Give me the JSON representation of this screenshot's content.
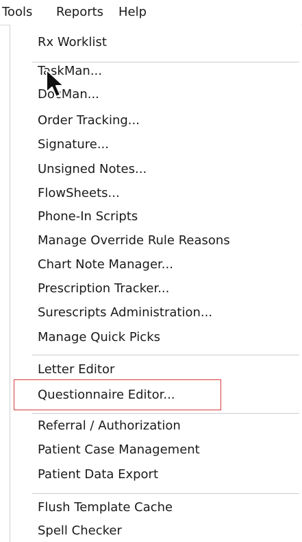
{
  "menubar": {
    "tools": "Tools",
    "reports": "Reports",
    "help": "Help"
  },
  "tools_menu": {
    "items": [
      "Rx Worklist",
      "TaskMan...",
      "DocMan...",
      "Order Tracking...",
      "Signature...",
      "Unsigned Notes...",
      "FlowSheets...",
      "Phone-In Scripts",
      "Manage Override Rule Reasons",
      "Chart Note Manager...",
      "Prescription Tracker...",
      "Surescripts Administration...",
      "Manage Quick Picks",
      "Letter Editor",
      "Questionnaire Editor...",
      "Referral / Authorization",
      "Patient Case Management",
      "Patient Data Export",
      "Flush Template Cache",
      "Spell Checker"
    ]
  },
  "highlight": {
    "color": "#d63a3a",
    "target": "Questionnaire Editor..."
  },
  "cursor_icon": "mouse-pointer-icon"
}
